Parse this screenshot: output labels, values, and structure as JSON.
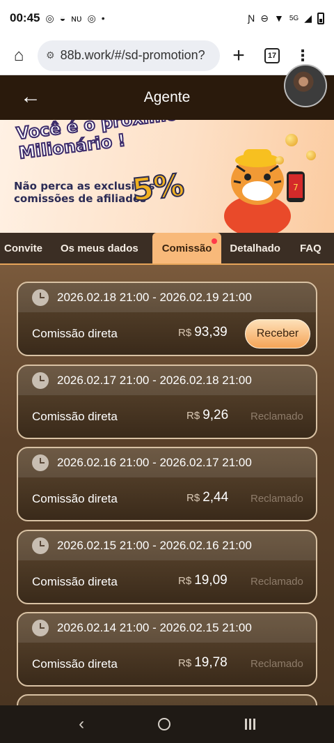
{
  "status_bar": {
    "time": "00:45",
    "network": "5G"
  },
  "browser": {
    "url": "88b.work/#/sd-promotion?",
    "tab_count": "17"
  },
  "header": {
    "title": "Agente"
  },
  "banner": {
    "headline": "Você é o próximo Milionário !",
    "subtext": "Não perca as exclusivas comissões de afiliados",
    "percent": "5%"
  },
  "tabs": [
    {
      "label": "Convite"
    },
    {
      "label": "Os meus dados"
    },
    {
      "label": "Comissão",
      "active": true
    },
    {
      "label": "Detalhado"
    },
    {
      "label": "FAQ"
    }
  ],
  "commissions": [
    {
      "date_range": "2026.02.18 21:00 - 2026.02.19 21:00",
      "label": "Comissão direta",
      "currency": "R$",
      "amount": "93,39",
      "action": "Receber"
    },
    {
      "date_range": "2026.02.17 21:00 - 2026.02.18 21:00",
      "label": "Comissão direta",
      "currency": "R$",
      "amount": "9,26",
      "status": "Reclamado"
    },
    {
      "date_range": "2026.02.16 21:00 - 2026.02.17 21:00",
      "label": "Comissão direta",
      "currency": "R$",
      "amount": "2,44",
      "status": "Reclamado"
    },
    {
      "date_range": "2026.02.15 21:00 - 2026.02.16 21:00",
      "label": "Comissão direta",
      "currency": "R$",
      "amount": "19,09",
      "status": "Reclamado"
    },
    {
      "date_range": "2026.02.14 21:00 - 2026.02.15 21:00",
      "label": "Comissão direta",
      "currency": "R$",
      "amount": "19,78",
      "status": "Reclamado"
    }
  ]
}
